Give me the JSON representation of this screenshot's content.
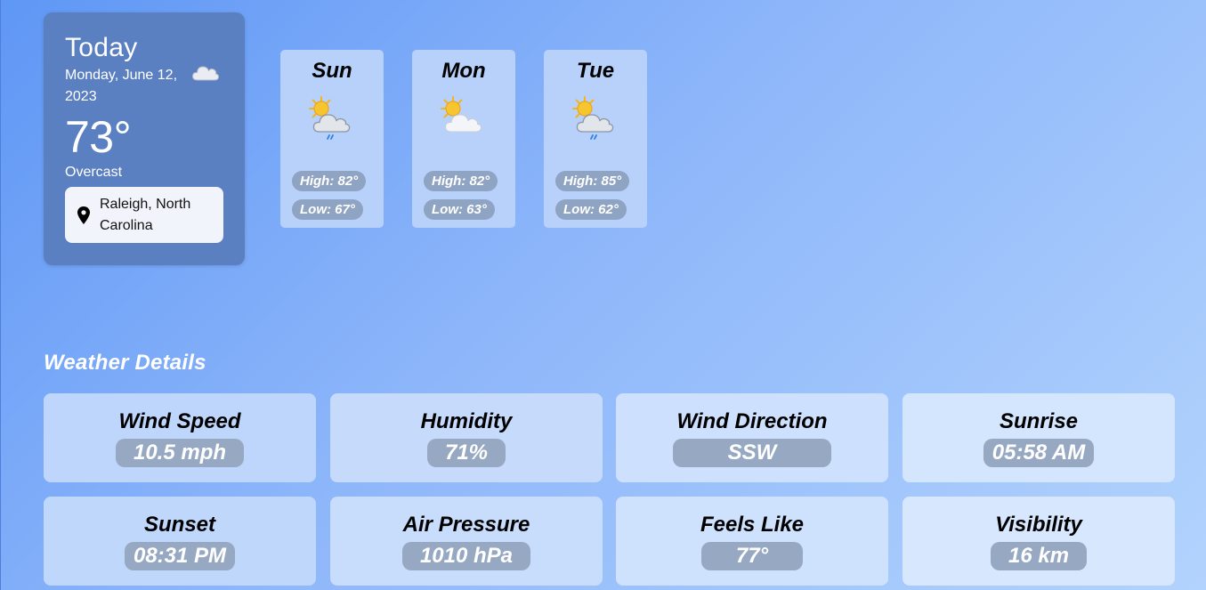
{
  "today": {
    "title": "Today",
    "date": "Monday, June 12, 2023",
    "icon": "cloud-icon",
    "temperature": "73°",
    "condition": "Overcast",
    "location": "Raleigh, North Carolina"
  },
  "forecast": [
    {
      "day": "Sun",
      "icon": "sun-cloud-rain-icon",
      "high": "High: 82°",
      "low": "Low: 67°"
    },
    {
      "day": "Mon",
      "icon": "sun-cloud-icon",
      "high": "High: 82°",
      "low": "Low: 63°"
    },
    {
      "day": "Tue",
      "icon": "sun-cloud-rain-icon",
      "high": "High: 85°",
      "low": "Low: 62°"
    }
  ],
  "details": {
    "title": "Weather Details",
    "items": [
      {
        "label": "Wind Speed",
        "value": "10.5 mph"
      },
      {
        "label": "Humidity",
        "value": "71%"
      },
      {
        "label": "Wind Direction",
        "value": "SSW"
      },
      {
        "label": "Sunrise",
        "value": "05:58 AM"
      },
      {
        "label": "Sunset",
        "value": "08:31 PM"
      },
      {
        "label": "Air Pressure",
        "value": "1010 hPa"
      },
      {
        "label": "Feels Like",
        "value": "77°"
      },
      {
        "label": "Visibility",
        "value": "16 km"
      }
    ]
  },
  "colors": {
    "background_start": "#5f97f5",
    "background_end": "#b2d3fd",
    "today_card": "#5a80c2",
    "forecast_card": "#b7d1fb",
    "pill": "#8fa3c2"
  }
}
